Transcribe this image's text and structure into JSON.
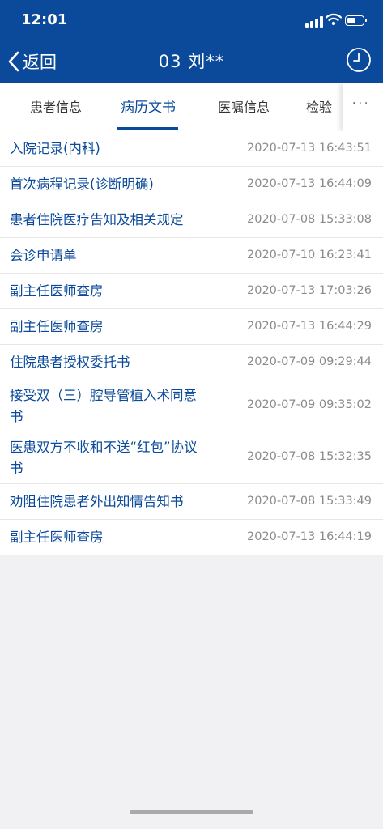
{
  "status": {
    "time": "12:01"
  },
  "nav": {
    "back_label": "返回",
    "title": "03  刘**"
  },
  "tabs": [
    {
      "label": "患者信息"
    },
    {
      "label": "病历文书"
    },
    {
      "label": "医嘱信息"
    },
    {
      "label": "检验"
    }
  ],
  "more_label": "···",
  "documents": [
    {
      "title": "入院记录(内科)",
      "date": "2020-07-13 16:43:51"
    },
    {
      "title": "首次病程记录(诊断明确)",
      "date": "2020-07-13 16:44:09"
    },
    {
      "title": "患者住院医疗告知及相关规定",
      "date": "2020-07-08 15:33:08"
    },
    {
      "title": "会诊申请单",
      "date": "2020-07-10 16:23:41"
    },
    {
      "title": "副主任医师查房",
      "date": "2020-07-13 17:03:26"
    },
    {
      "title": "副主任医师查房",
      "date": "2020-07-13 16:44:29"
    },
    {
      "title": "住院患者授权委托书",
      "date": "2020-07-09 09:29:44"
    },
    {
      "title_lines": [
        "接受双（三）腔导管植入术同意",
        "书"
      ],
      "date": "2020-07-09 09:35:02"
    },
    {
      "title_lines": [
        "医患双方不收和不送“红包”协议",
        "书"
      ],
      "date": "2020-07-08 15:32:35"
    },
    {
      "title": "劝阻住院患者外出知情告知书",
      "date": "2020-07-08 15:33:49"
    },
    {
      "title": "副主任医师查房",
      "date": "2020-07-13 16:44:19"
    }
  ],
  "colors": {
    "primary": "#0b4a9b",
    "date_text": "#8b8b8b",
    "background": "#f1f1f3"
  },
  "icons": {
    "back": "chevron-left-icon",
    "history": "clock-icon"
  }
}
